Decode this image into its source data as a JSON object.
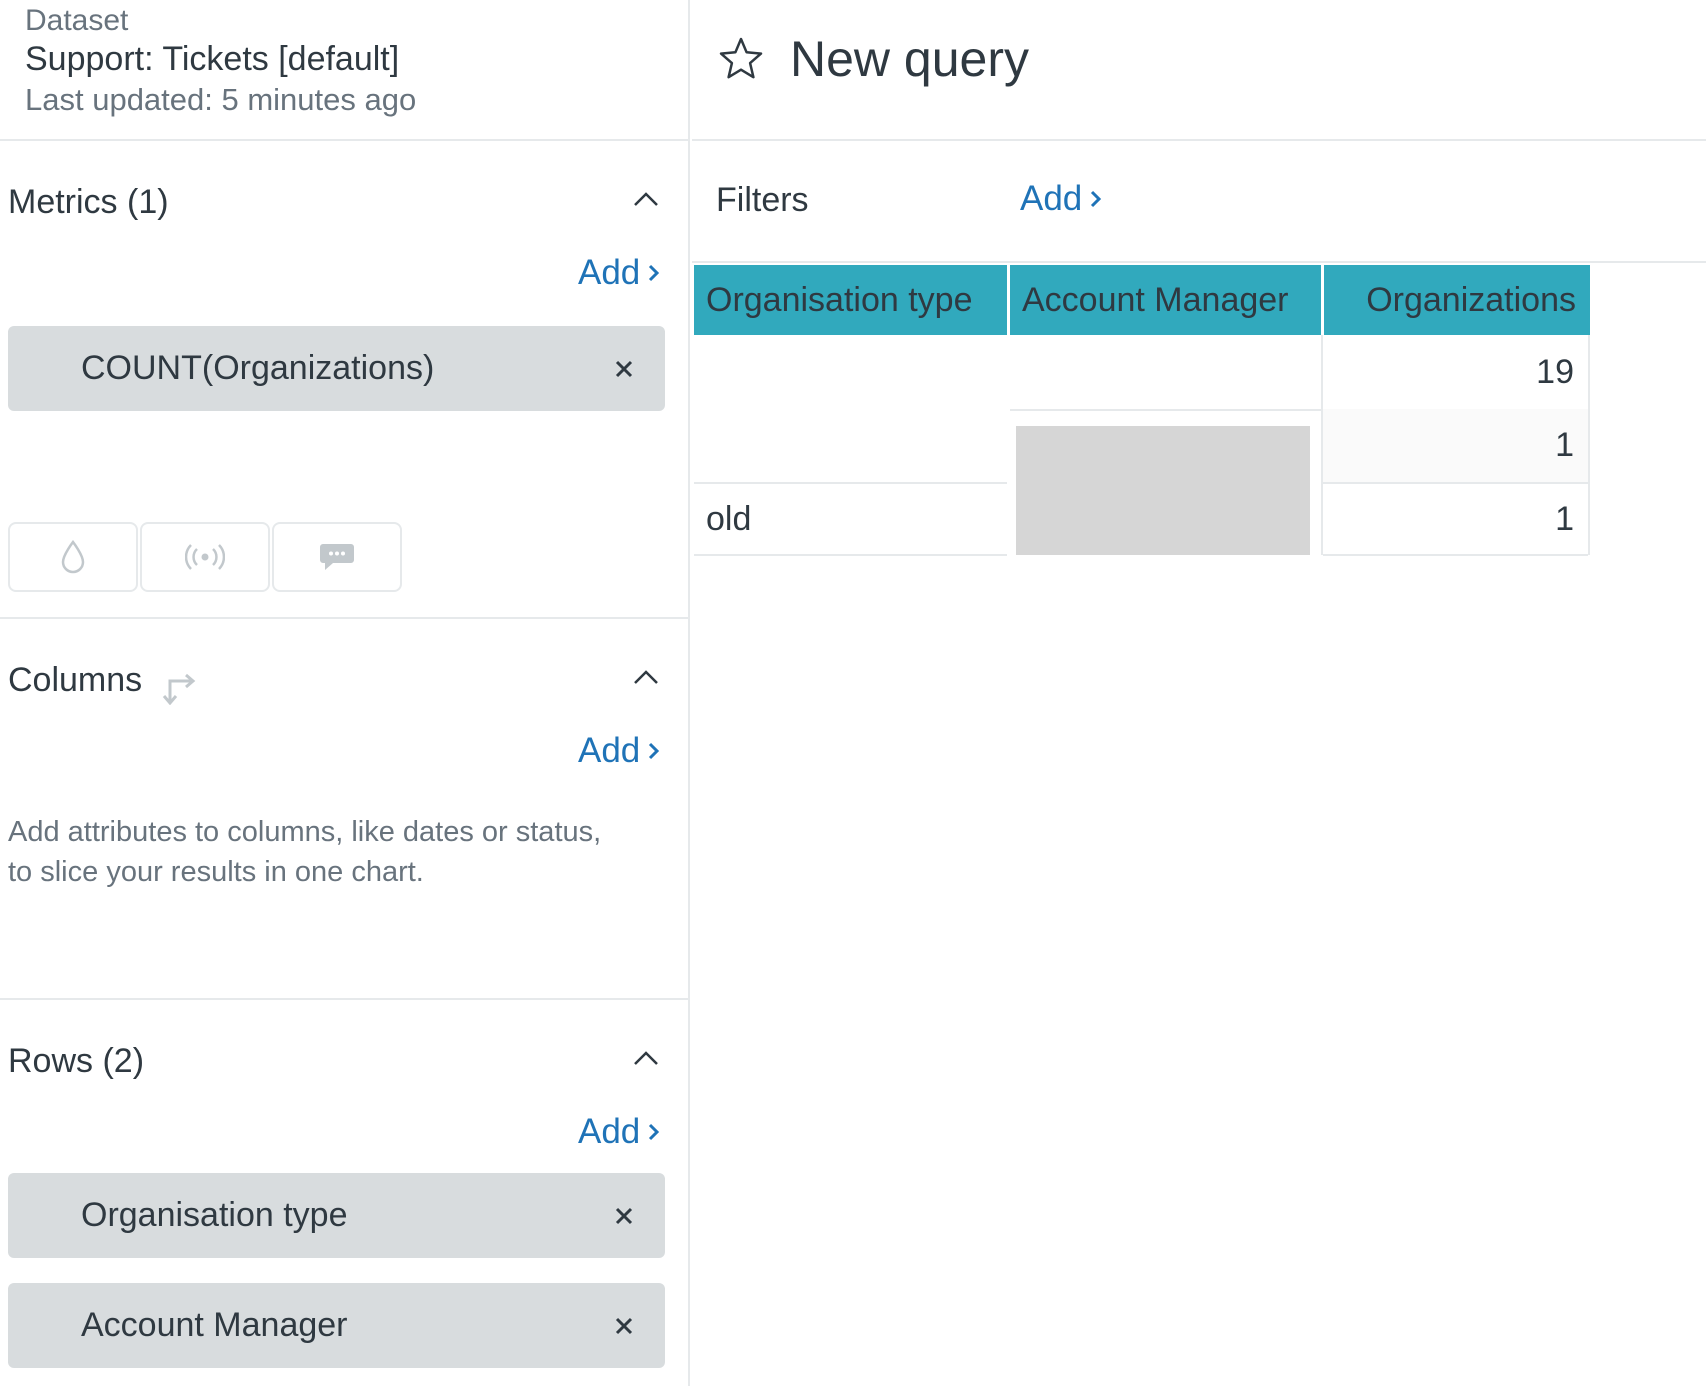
{
  "dataset": {
    "label": "Dataset",
    "name": "Support: Tickets [default]",
    "last_updated": "Last updated: 5 minutes ago"
  },
  "metrics": {
    "title": "Metrics (1)",
    "add_label": "Add",
    "items": [
      {
        "label": "COUNT(Organizations)"
      }
    ],
    "tool_icons": [
      "drop-icon",
      "broadcast-icon",
      "speech-bubble-icon"
    ]
  },
  "columns": {
    "title": "Columns",
    "add_label": "Add",
    "help": "Add attributes to columns, like dates or status, to slice your results in one chart."
  },
  "rows": {
    "title": "Rows (2)",
    "add_label": "Add",
    "items": [
      {
        "label": "Organisation type"
      },
      {
        "label": "Account Manager"
      }
    ]
  },
  "query": {
    "title": "New query"
  },
  "filters": {
    "label": "Filters",
    "add_label": "Add"
  },
  "table": {
    "headers": [
      "Organisation type",
      "Account Manager",
      "Organizations"
    ],
    "rows": [
      {
        "org_type": "",
        "account_manager": "",
        "organizations": "19"
      },
      {
        "org_type": "",
        "account_manager": "",
        "organizations": "1"
      },
      {
        "org_type": "old",
        "account_manager": "",
        "organizations": "1"
      }
    ]
  },
  "colors": {
    "accent_link": "#1f73b7",
    "header_teal": "#31a9bd",
    "pill_grey": "#d8dcde",
    "redacted_grey": "#d6d6d6"
  }
}
